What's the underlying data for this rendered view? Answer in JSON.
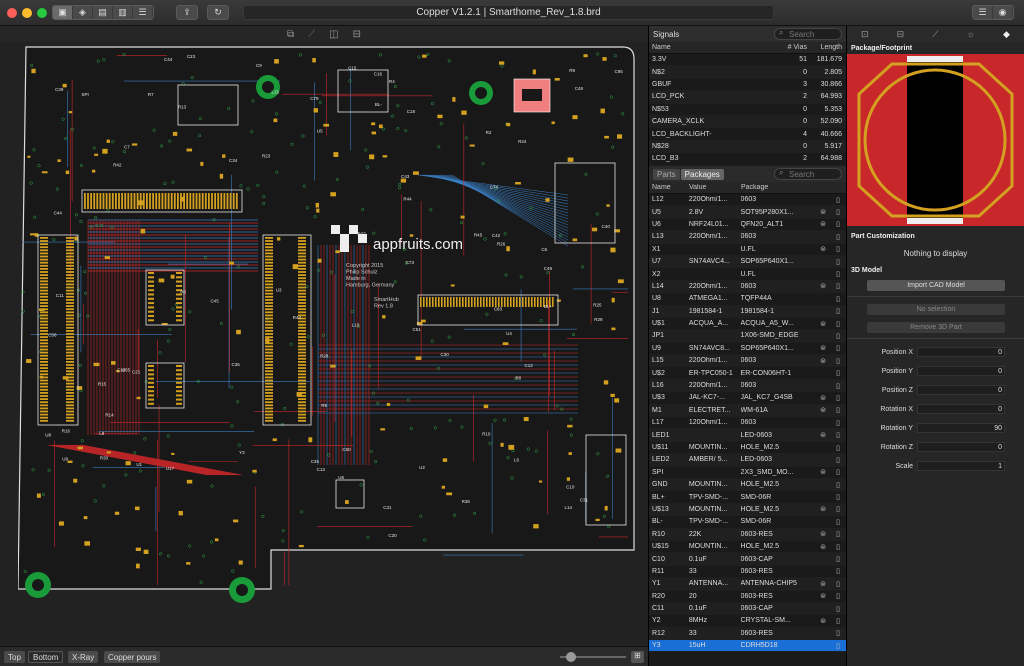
{
  "window": {
    "title": "Copper V1.2.1 | Smarthome_Rev_1.8.brd"
  },
  "toolbar": {
    "view_icons": [
      "layers-view-icon",
      "stack-icon",
      "document-icon",
      "clipboard-icon",
      "list-icon"
    ],
    "share": "⇪",
    "refresh": "↻"
  },
  "board": {
    "logo_text": "appfruits.com",
    "copyright": "Copyright 2015\nPhilip Schulz\nMade in\nHamburg, Germany",
    "product": "SmartHub\nRev 1.8",
    "labels": [
      "C15",
      "C14",
      "C16",
      "U6",
      "R16",
      "R15",
      "C20",
      "C21",
      "C18",
      "R14",
      "C12",
      "C13",
      "U3",
      "C9",
      "C95",
      "U4",
      "R42",
      "U5",
      "R44",
      "R43",
      "C45",
      "C44",
      "C43",
      "C42",
      "C48",
      "U8",
      "R13",
      "U9",
      "C40",
      "C39",
      "R25",
      "R26",
      "R28",
      "R29",
      "R24",
      "C31",
      "R23",
      "L15",
      "C30",
      "C31",
      "C49",
      "L9",
      "L14",
      "L13",
      "C50",
      "C51",
      "R10",
      "C23",
      "C7",
      "C6",
      "U2",
      "R2",
      "U1",
      "C11",
      "L6",
      "C44",
      "R45",
      "C73",
      "C74",
      "R30",
      "R37",
      "R36",
      "C79",
      "C10",
      "U17",
      "C55",
      "C56",
      "R4",
      "R5",
      "R6",
      "R7",
      "R8",
      "R9",
      "C34",
      "C35",
      "C36",
      "Y3",
      "C83",
      "BL+",
      "BL-",
      "SPI"
    ]
  },
  "bottom_bar": {
    "top": "Top",
    "bottom": "Bottom",
    "xray": "X-Ray",
    "pours": "Copper pours"
  },
  "signals": {
    "title": "Signals",
    "search_placeholder": "Search",
    "columns": [
      "Name",
      "# Vias",
      "Length"
    ],
    "rows": [
      [
        "3.3V",
        "51",
        "181.679"
      ],
      [
        "N$2",
        "0",
        "2.805"
      ],
      [
        "GBUF",
        "3",
        "30.866"
      ],
      [
        "LCD_PCK",
        "2",
        "64.993"
      ],
      [
        "N$53",
        "0",
        "5.353"
      ],
      [
        "CAMERA_XCLK",
        "0",
        "52.090"
      ],
      [
        "LCD_BACKLIGHT-",
        "4",
        "40.666"
      ],
      [
        "N$28",
        "0",
        "5.917"
      ],
      [
        "LCD_B3",
        "2",
        "64.988"
      ]
    ]
  },
  "parts": {
    "tab_parts": "Parts",
    "tab_packages": "Packages",
    "search_placeholder": "Search",
    "columns": [
      "Name",
      "Value",
      "Package"
    ],
    "rows": [
      [
        "L12",
        "220Ohm/1...",
        "0603"
      ],
      [
        "U5",
        "2.8V",
        "SOT95P280X1..."
      ],
      [
        "U6",
        "NRF24L01...",
        "QFN20_ALT1"
      ],
      [
        "L13",
        "220Ohm/1...",
        "0603"
      ],
      [
        "X1",
        "",
        "U.FL"
      ],
      [
        "U7",
        "SN74AVC4...",
        "SOP65P640X1..."
      ],
      [
        "X2",
        "",
        "U.FL"
      ],
      [
        "L14",
        "220Ohm/1...",
        "0603"
      ],
      [
        "U8",
        "ATMEGA1...",
        "TQFP44A"
      ],
      [
        "J1",
        "1981584-1",
        "1981584-1"
      ],
      [
        "U$1",
        "ACQUA_A...",
        "ACQUA_A5_W..."
      ],
      [
        "JP1",
        "",
        "1X06-SMD_EDGE"
      ],
      [
        "U9",
        "SN74AVC8...",
        "SOP65P640X1..."
      ],
      [
        "L15",
        "220Ohm/1...",
        "0603"
      ],
      [
        "U$2",
        "ER-TPC050-1",
        "ER-CON06HT-1"
      ],
      [
        "L16",
        "220Ohm/1...",
        "0603"
      ],
      [
        "U$3",
        "JAL-KC7-...",
        "JAL_KC7_G4SB"
      ],
      [
        "M1",
        "ELECTRET...",
        "WM-61A"
      ],
      [
        "L17",
        "120Ohm/1...",
        "0603"
      ],
      [
        "LED1",
        "",
        "LED-0603"
      ],
      [
        "U$11",
        "MOUNTIN...",
        "HOLE_M2.5"
      ],
      [
        "LED2",
        "AMBER/ 5...",
        "LED-0603"
      ],
      [
        "SPI",
        "",
        "2X3_SMD_MO..."
      ],
      [
        "GND",
        "MOUNTIN...",
        "HOLE_M2.5"
      ],
      [
        "BL+",
        "TPV-SMD-...",
        "SMD-06R"
      ],
      [
        "U$13",
        "MOUNTIN...",
        "HOLE_M2.5"
      ],
      [
        "BL-",
        "TPV-SMD-...",
        "SMD-06R"
      ],
      [
        "R10",
        "22K",
        "0603-RES"
      ],
      [
        "U$15",
        "MOUNTIN...",
        "HOLE_M2.5"
      ],
      [
        "C10",
        "0.1uF",
        "0603-CAP"
      ],
      [
        "R11",
        "33",
        "0603-RES"
      ],
      [
        "Y1",
        "ANTENNA...",
        "ANTENNA-CHIP5"
      ],
      [
        "R20",
        "20",
        "0603-RES"
      ],
      [
        "C11",
        "0.1uF",
        "0603-CAP"
      ],
      [
        "Y2",
        "8MHz",
        "CRYSTAL-SM..."
      ],
      [
        "R12",
        "33",
        "0603-RES"
      ],
      [
        "Y3",
        "15uH",
        "CDRH5D18"
      ]
    ]
  },
  "inspector": {
    "package_title": "Package/Footprint",
    "customization_title": "Part Customization",
    "nothing": "Nothing to display",
    "model_title": "3D Model",
    "import_btn": "Import CAD Model",
    "no_selection": "No selection",
    "remove_btn": "Remove 3D Part",
    "fields": [
      {
        "label": "Position X",
        "value": "0"
      },
      {
        "label": "Position Y",
        "value": "0"
      },
      {
        "label": "Position Z",
        "value": "0"
      },
      {
        "label": "Rotation X",
        "value": "0"
      },
      {
        "label": "Rotation Y",
        "value": "90"
      },
      {
        "label": "Rotation Z",
        "value": "0"
      },
      {
        "label": "Scale",
        "value": "1"
      }
    ]
  },
  "colors": {
    "copper_top": "#c8282a",
    "copper_bottom": "#3a7fc4",
    "silk": "#e8e8e8",
    "pad": "#d4a020",
    "selection": "#1a6fd6"
  }
}
